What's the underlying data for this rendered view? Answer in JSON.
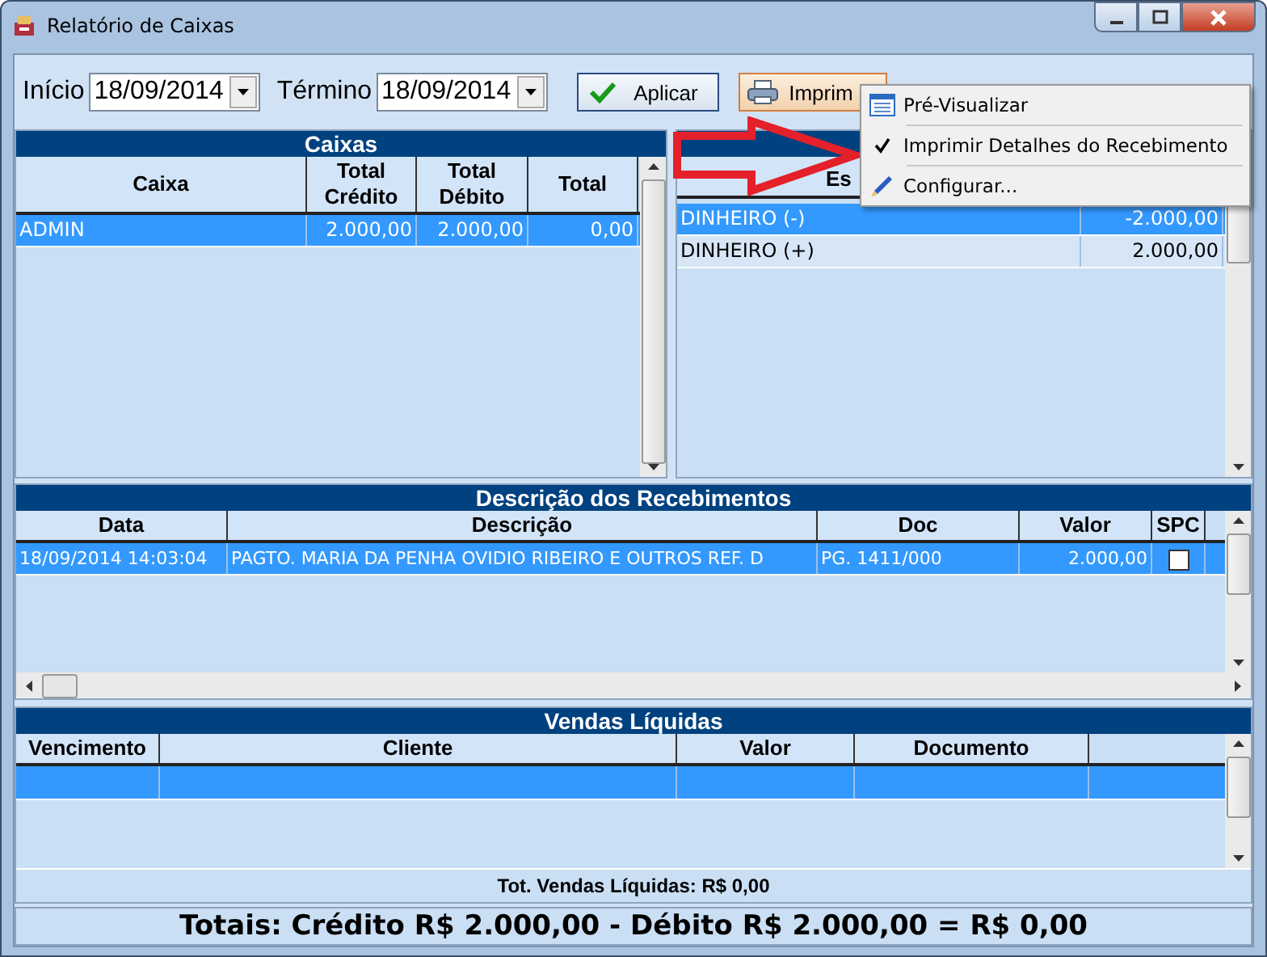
{
  "window": {
    "title": "Relatório de Caixas"
  },
  "filters": {
    "start_label": "Início",
    "start_value": "18/09/2014",
    "end_label": "Término",
    "end_value": "18/09/2014"
  },
  "buttons": [
    {
      "label": "Aplicar",
      "kind": "apply"
    },
    {
      "label": "Imprim",
      "kind": "print"
    }
  ],
  "print_menu": [
    {
      "label": "Pré-Visualizar",
      "kind": "preview"
    },
    {
      "label": "Imprimir Detalhes do Recebimento",
      "kind": "check",
      "checked": true
    },
    {
      "label": "Configurar...",
      "kind": "config"
    }
  ],
  "caixas": {
    "title": "Caixas",
    "columns": [
      "Caixa",
      "Total\nCrédito",
      "Total\nDébito",
      "Total"
    ],
    "rows": [
      {
        "cells": [
          "ADMIN",
          "2.000,00",
          "2.000,00",
          "0,00"
        ],
        "selected": true
      }
    ]
  },
  "especies": {
    "columns": [
      "Es"
    ],
    "rows": [
      {
        "cells": [
          "DINHEIRO (-)",
          "-2.000,00"
        ],
        "selected": true
      },
      {
        "cells": [
          "DINHEIRO (+)",
          "2.000,00"
        ],
        "selected": false
      }
    ]
  },
  "recebimentos": {
    "title": "Descrição dos Recebimentos",
    "columns": [
      "Data",
      "Descrição",
      "Doc",
      "Valor",
      "SPC"
    ],
    "rows": [
      {
        "cells": [
          "18/09/2014 14:03:04",
          "PAGTO. MARIA DA PENHA OVIDIO RIBEIRO E OUTROS REF. D",
          "PG. 1411/000",
          "2.000,00"
        ],
        "spc": false,
        "selected": true
      }
    ]
  },
  "vendas": {
    "title": "Vendas Líquidas",
    "columns": [
      "Vencimento",
      "Cliente",
      "Valor",
      "Documento"
    ],
    "rows": [
      {
        "selected": true
      }
    ]
  },
  "vendas_total": "Tot. Vendas Líquidas: R$ 0,00",
  "totals": "Totais: Crédito R$ 2.000,00 - Débito R$ 2.000,00 = R$ 0,00"
}
